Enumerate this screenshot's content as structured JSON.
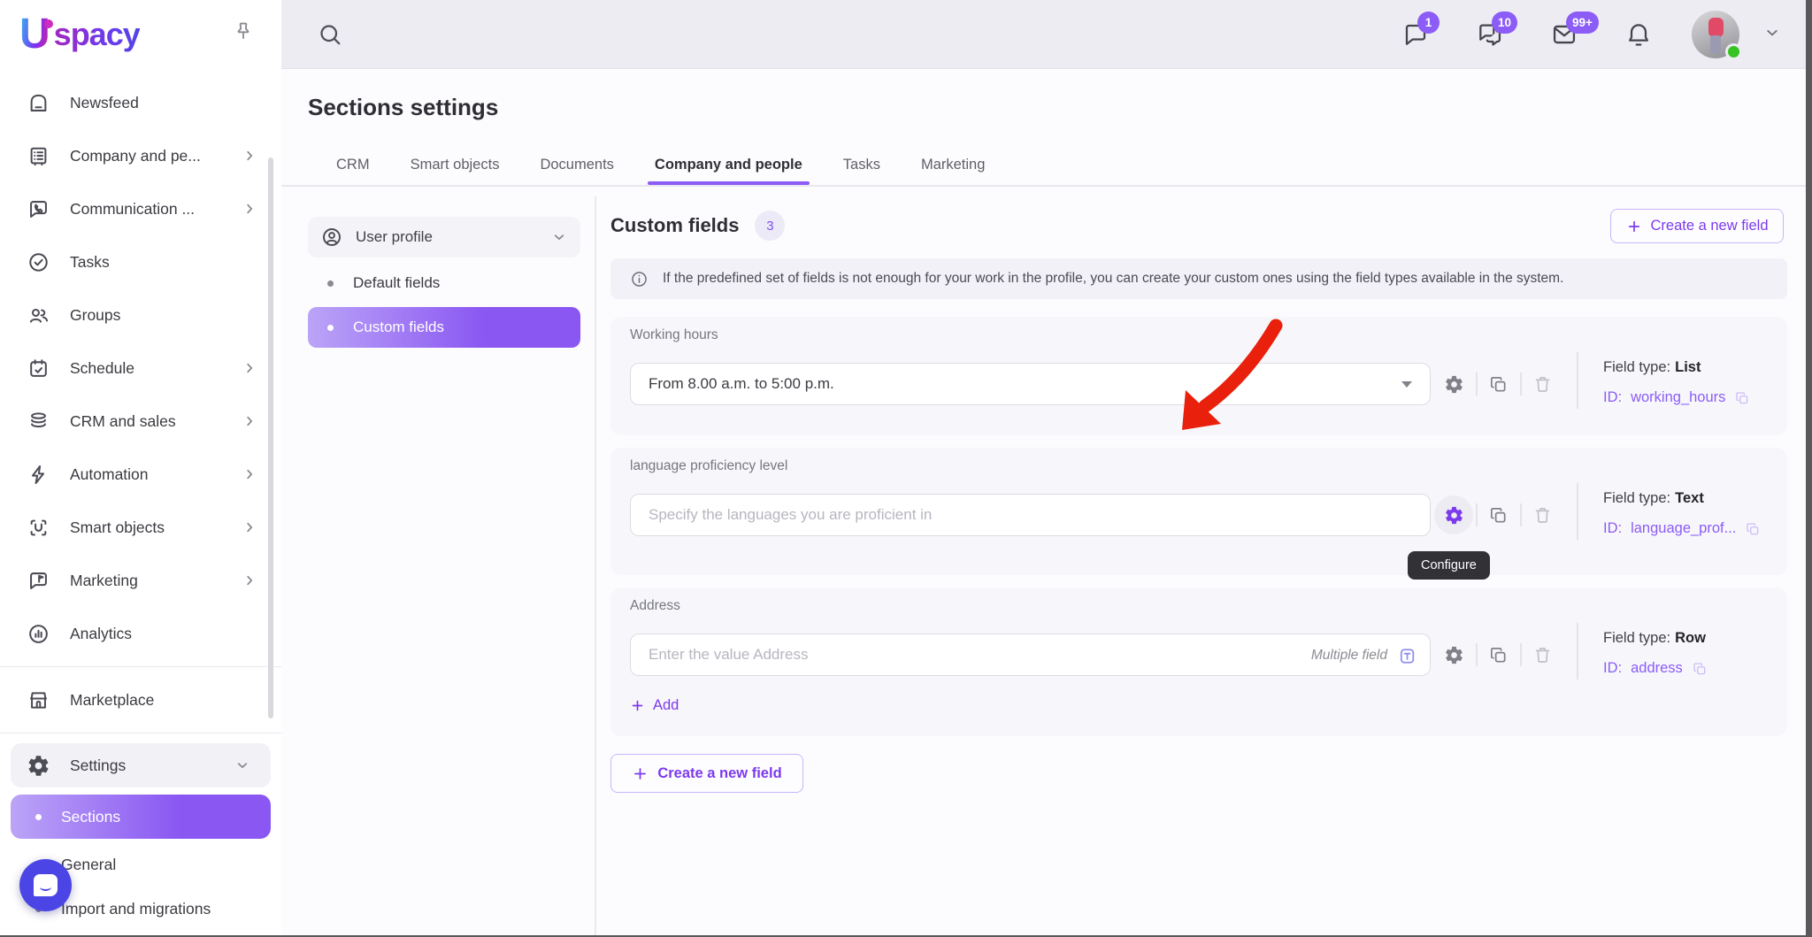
{
  "brand": {
    "logo_letter": "U",
    "logo_text": "spacy"
  },
  "topbar": {
    "chat_badge": "1",
    "team_chat_badge": "10",
    "mail_badge": "99+"
  },
  "sidebar": {
    "items": [
      {
        "label": "Newsfeed"
      },
      {
        "label": "Company and pe..."
      },
      {
        "label": "Communication ..."
      },
      {
        "label": "Tasks"
      },
      {
        "label": "Groups"
      },
      {
        "label": "Schedule"
      },
      {
        "label": "CRM and sales"
      },
      {
        "label": "Automation"
      },
      {
        "label": "Smart objects"
      },
      {
        "label": "Marketing"
      },
      {
        "label": "Analytics"
      },
      {
        "label": "Marketplace"
      },
      {
        "label": "Settings"
      },
      {
        "label": "Sections"
      },
      {
        "label": "General"
      },
      {
        "label": "Import and migrations"
      }
    ]
  },
  "header": {
    "title": "Sections settings",
    "tabs": [
      {
        "label": "CRM"
      },
      {
        "label": "Smart objects"
      },
      {
        "label": "Documents"
      },
      {
        "label": "Company and people"
      },
      {
        "label": "Tasks"
      },
      {
        "label": "Marketing"
      }
    ]
  },
  "subnav": {
    "group_label": "User profile",
    "items": [
      {
        "label": "Default fields"
      },
      {
        "label": "Custom fields"
      }
    ]
  },
  "content": {
    "heading": "Custom fields",
    "count": "3",
    "create_button": "Create a new field",
    "banner": "If the predefined set of fields is not enough for your work in the profile, you can create your custom ones using the field types available in the system.",
    "fields": [
      {
        "label": "Working hours",
        "value": "From 8.00 a.m. to 5:00 p.m.",
        "field_type_label": "Field type:",
        "field_type": "List",
        "id_label": "ID:",
        "id": "working_hours"
      },
      {
        "label": "language proficiency level",
        "placeholder": "Specify the languages you are proficient in",
        "field_type_label": "Field type:",
        "field_type": "Text",
        "id_label": "ID:",
        "id": "language_prof...",
        "tooltip": "Configure"
      },
      {
        "label": "Address",
        "placeholder": "Enter the value Address",
        "multiple_label": "Multiple field",
        "field_type_label": "Field type:",
        "field_type": "Row",
        "id_label": "ID:",
        "id": "address",
        "add_label": "Add"
      }
    ],
    "bottom_create_button": "Create a new field"
  },
  "colors": {
    "accent": "#7c3aed",
    "badge_purple": "#8b5cf6",
    "tab_underline": "#8b5cf6",
    "arrow_red": "#e8200c",
    "tooltip_bg": "#313136",
    "online_green": "#35c421"
  }
}
